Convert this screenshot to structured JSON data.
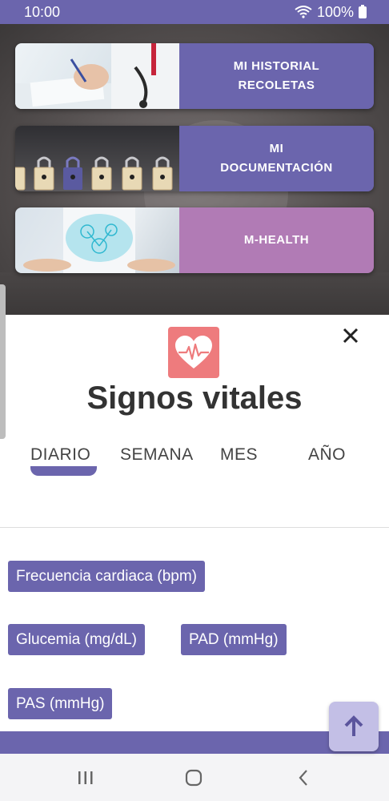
{
  "status_bar": {
    "time": "10:00",
    "battery": "100%",
    "icons": [
      "wifi-icon",
      "battery-icon"
    ]
  },
  "menu": {
    "cards": [
      {
        "line1": "MI HISTORIAL",
        "line2": "RECOLETAS",
        "image": "doctor-writing-image"
      },
      {
        "line1": "MI",
        "line2": "DOCUMENTACIÓN",
        "image": "padlocks-image"
      },
      {
        "line1": "M-HEALTH",
        "line2": "",
        "image": "digital-health-image"
      }
    ]
  },
  "sheet": {
    "title": "Signos vitales",
    "icon": "heart-pulse-icon",
    "tabs": [
      {
        "label": "DIARIO",
        "active": true
      },
      {
        "label": "SEMANA",
        "active": false
      },
      {
        "label": "MES",
        "active": false
      },
      {
        "label": "AÑO",
        "active": false
      }
    ],
    "chips": [
      "Frecuencia cardiaca (bpm)",
      "Glucemia (mg/dL)",
      "PAD (mmHg)",
      "PAS (mmHg)"
    ]
  },
  "colors": {
    "primary": "#6b65ad",
    "pink": "#b17bb5",
    "heart": "#ee7b7d",
    "fab": "#c3bfe6"
  },
  "nav": {
    "buttons": [
      "recents-icon",
      "home-icon",
      "back-icon"
    ]
  }
}
